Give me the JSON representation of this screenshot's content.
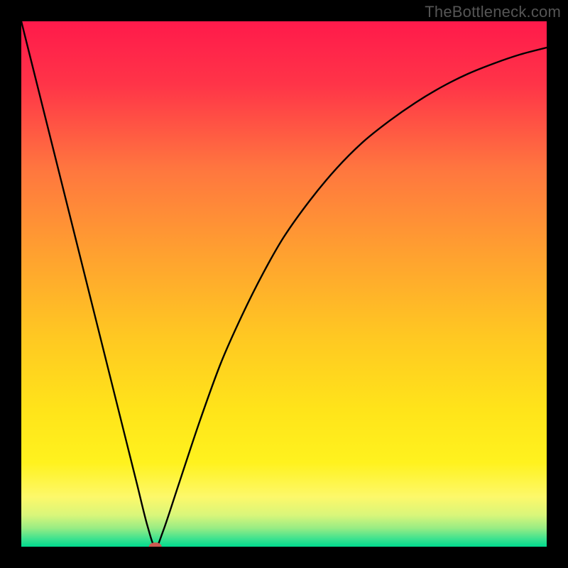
{
  "watermark": "TheBottleneck.com",
  "chart_data": {
    "type": "line",
    "title": "",
    "xlabel": "",
    "ylabel": "",
    "xlim": [
      0,
      100
    ],
    "ylim": [
      0,
      100
    ],
    "background_gradient": {
      "stops": [
        {
          "offset": 0.0,
          "color": "#ff1a4b"
        },
        {
          "offset": 0.12,
          "color": "#ff3448"
        },
        {
          "offset": 0.28,
          "color": "#ff763f"
        },
        {
          "offset": 0.44,
          "color": "#ffa030"
        },
        {
          "offset": 0.6,
          "color": "#ffc822"
        },
        {
          "offset": 0.74,
          "color": "#ffe41a"
        },
        {
          "offset": 0.84,
          "color": "#fff21e"
        },
        {
          "offset": 0.905,
          "color": "#fdf86a"
        },
        {
          "offset": 0.94,
          "color": "#d9f67a"
        },
        {
          "offset": 0.965,
          "color": "#97ec84"
        },
        {
          "offset": 0.985,
          "color": "#3de28f"
        },
        {
          "offset": 1.0,
          "color": "#00da8e"
        }
      ]
    },
    "series": [
      {
        "name": "bottleneck-curve",
        "x": [
          0,
          4,
          8,
          12,
          16,
          20,
          22,
          24,
          25.5,
          27,
          30,
          34,
          38,
          42,
          46,
          50,
          55,
          60,
          65,
          70,
          75,
          80,
          85,
          90,
          95,
          100
        ],
        "y": [
          100,
          84,
          68,
          52,
          36,
          20,
          12,
          4,
          0,
          3,
          12,
          24,
          35,
          44,
          52,
          59,
          66,
          72,
          77,
          81,
          84.5,
          87.5,
          90,
          92,
          93.7,
          95
        ],
        "note": "V-shaped curve; left limb nearly linear descending from (0,100) to minimum near x≈25.5; right limb rises with decreasing slope toward ~95 at x=100."
      }
    ],
    "marker": {
      "name": "optimal-point",
      "x": 25.5,
      "y": 0,
      "color": "#cc5a52",
      "rx": 9,
      "ry": 6
    }
  }
}
